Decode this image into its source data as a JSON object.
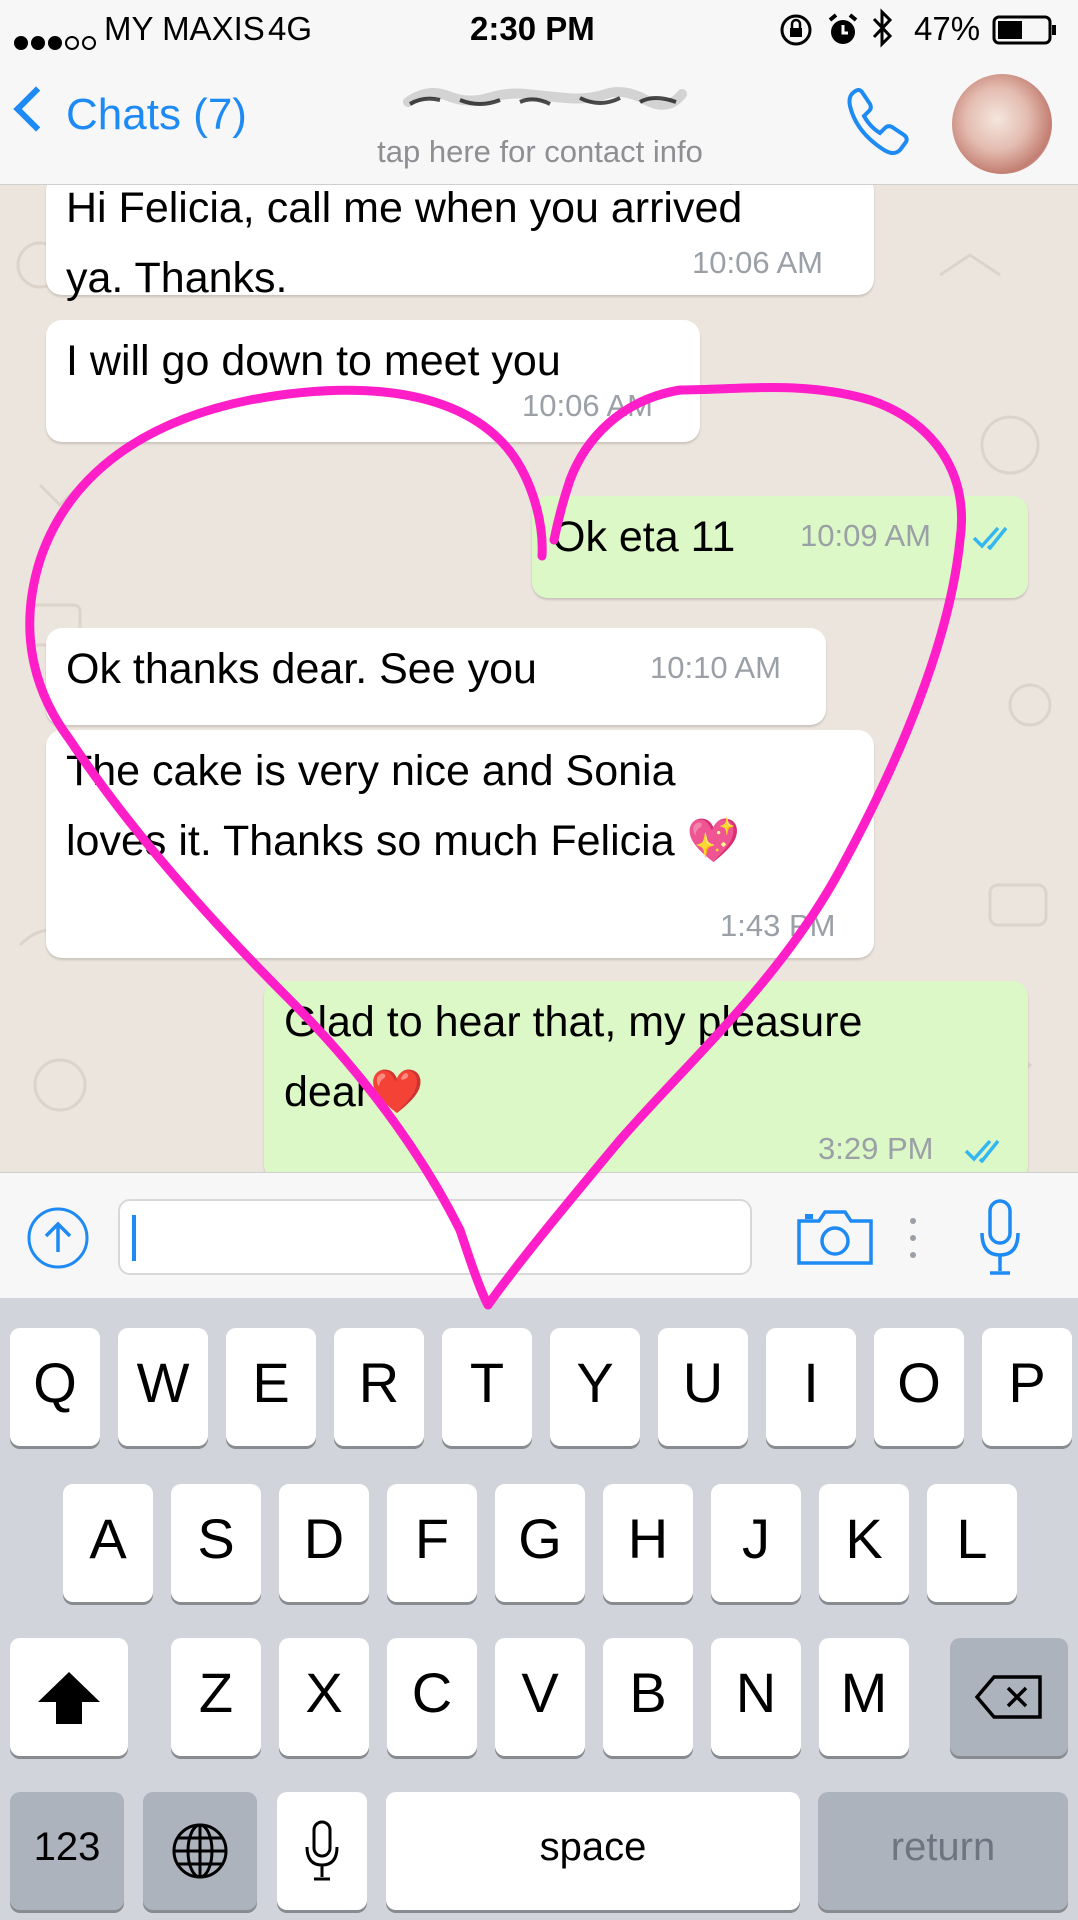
{
  "status_bar": {
    "carrier": "MY MAXIS",
    "network": "4G",
    "time": "2:30 PM",
    "battery": "47%"
  },
  "nav": {
    "back_label": "Chats (7)",
    "subtitle": "tap here for contact info"
  },
  "messages": [
    {
      "direction": "in",
      "lines": [
        "Hi Felicia,  call me when you arrived",
        "ya. Thanks."
      ],
      "time": "10:06 AM"
    },
    {
      "direction": "in",
      "lines": [
        "I will go down to meet you"
      ],
      "time": "10:06 AM"
    },
    {
      "direction": "out",
      "lines": [
        "Ok eta 11"
      ],
      "time": "10:09 AM",
      "read": true
    },
    {
      "direction": "in",
      "lines": [
        "Ok thanks dear. See you"
      ],
      "time": "10:10 AM"
    },
    {
      "direction": "in",
      "lines": [
        "The cake is very nice and Sonia",
        "loves it. Thanks so much Felicia 💖"
      ],
      "time": "1:43 PM"
    },
    {
      "direction": "out",
      "lines": [
        "Glad to hear that, my pleasure",
        "dear❤️"
      ],
      "time": "3:29 PM",
      "read": true
    }
  ],
  "input": {
    "value": ""
  },
  "keyboard": {
    "row1": [
      "Q",
      "W",
      "E",
      "R",
      "T",
      "Y",
      "U",
      "I",
      "O",
      "P"
    ],
    "row2": [
      "A",
      "S",
      "D",
      "F",
      "G",
      "H",
      "J",
      "K",
      "L"
    ],
    "row3": [
      "Z",
      "X",
      "C",
      "V",
      "B",
      "N",
      "M"
    ],
    "numbers_label": "123",
    "space_label": "space",
    "return_label": "return"
  },
  "colors": {
    "accent": "#1e8af4",
    "outgoing_bubble": "#dcf8c6",
    "incoming_bubble": "#ffffff",
    "chat_background": "#ece5dd",
    "annotation_heart": "#ff1ec8"
  },
  "icons": [
    "back-chevron-icon",
    "phone-icon",
    "upload-arrow-icon",
    "camera-icon",
    "microphone-icon",
    "shift-icon",
    "backspace-icon",
    "globe-icon",
    "keyboard-mic-icon",
    "double-check-icon"
  ]
}
